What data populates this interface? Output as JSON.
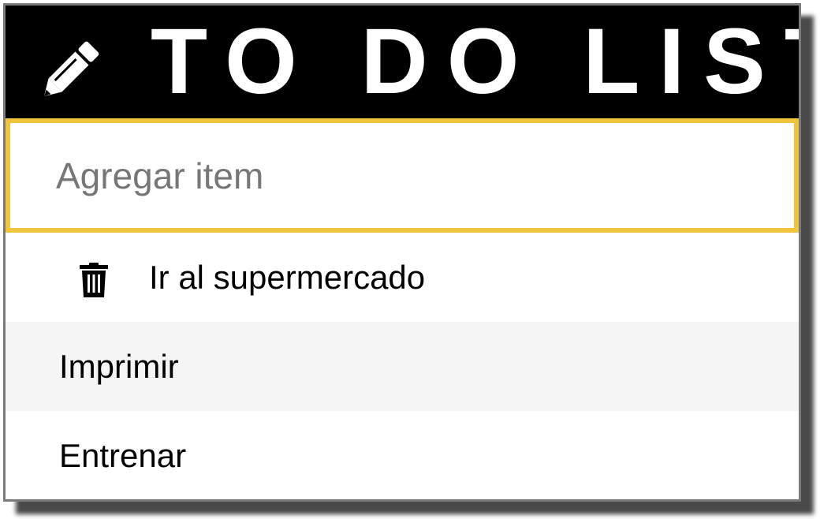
{
  "header": {
    "title": "TO DO LIST",
    "icon": "pencil-icon",
    "background": "#000000",
    "text_color": "#ffffff"
  },
  "input": {
    "placeholder": "Agregar item",
    "value": "",
    "border_color": "#f0c53d"
  },
  "todos": [
    {
      "label": "Ir al supermercado",
      "delete_icon": "trash-icon"
    },
    {
      "label": "Imprimir"
    },
    {
      "label": "Entrenar"
    }
  ],
  "colors": {
    "row_alt": "#f5f5f5",
    "frame": "#7a7a7a"
  }
}
